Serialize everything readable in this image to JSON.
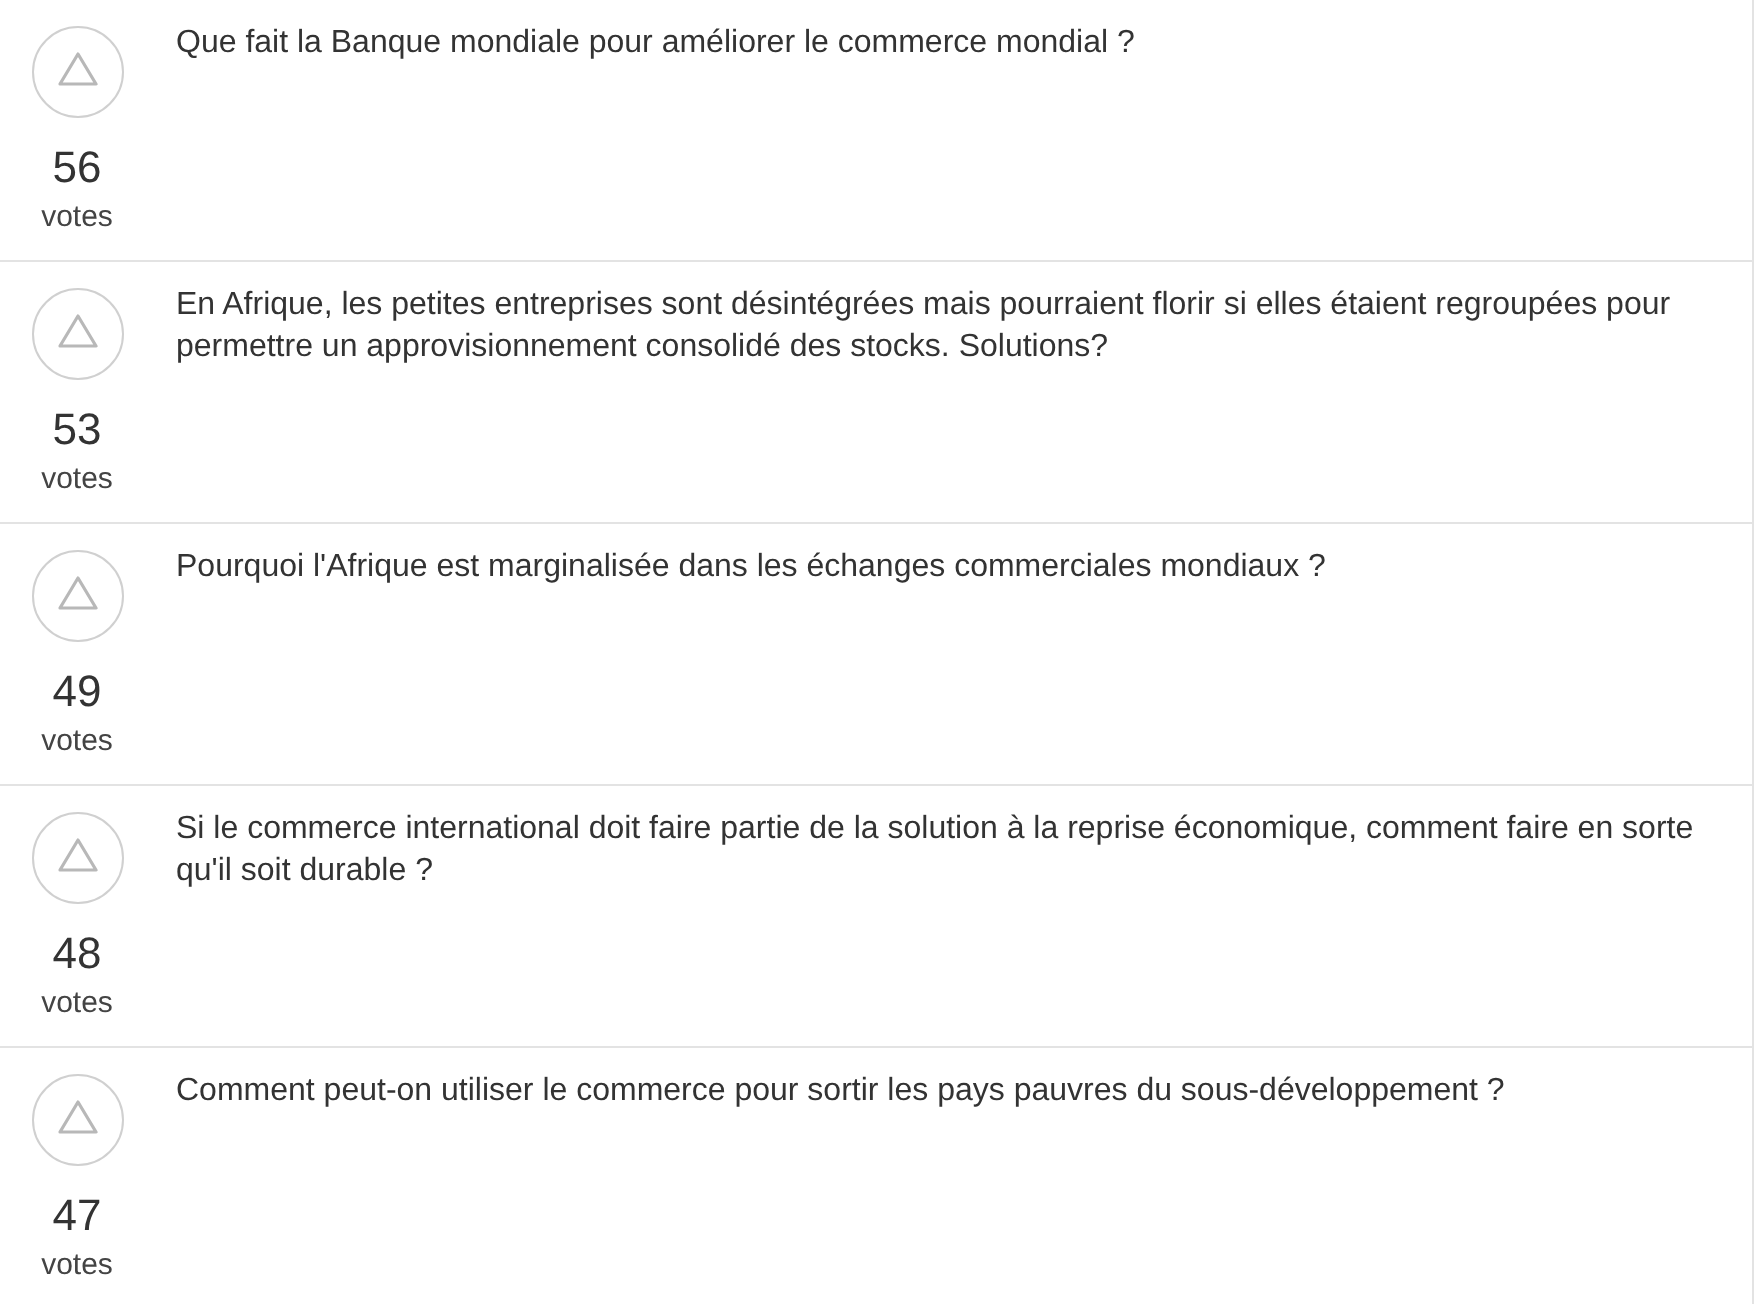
{
  "questions": [
    {
      "text": "Que fait la Banque mondiale pour améliorer le commerce mondial ?",
      "votes": "56",
      "votes_label": "votes"
    },
    {
      "text": "En Afrique, les petites entreprises sont désintégrées mais pourraient florir si elles étaient regroupées pour permettre un approvisionnement consolidé des stocks. Solutions?",
      "votes": "53",
      "votes_label": "votes"
    },
    {
      "text": "Pourquoi l'Afrique est marginalisée dans les échanges commerciales mondiaux ?",
      "votes": "49",
      "votes_label": "votes"
    },
    {
      "text": "Si le commerce international doit faire partie de la solution à la reprise économique, comment faire en sorte qu'il soit durable ?",
      "votes": "48",
      "votes_label": "votes"
    },
    {
      "text": "Comment peut-on utiliser le commerce pour sortir les pays pauvres du sous-développement ?",
      "votes": "47",
      "votes_label": "votes"
    }
  ]
}
